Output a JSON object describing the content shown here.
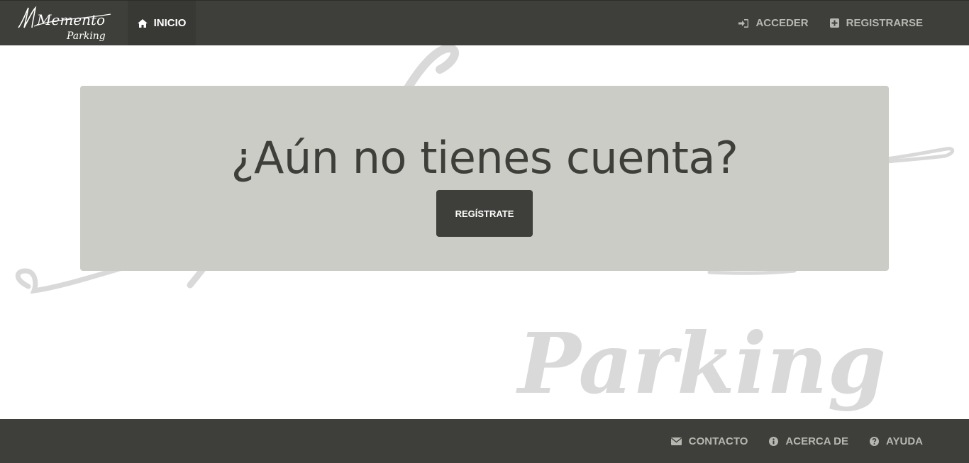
{
  "brand": {
    "logo_text": "Memento",
    "logo_subtext": "Parking"
  },
  "nav": {
    "home": {
      "label": "INICIO",
      "icon": "home-icon"
    },
    "login": {
      "label": "ACCEDER",
      "icon": "sign-in-icon"
    },
    "register": {
      "label": "REGISTRARSE",
      "icon": "plus-square-icon"
    }
  },
  "watermark": {
    "text": "Parking"
  },
  "hero": {
    "title": "¿Aún no tienes cuenta?",
    "button_label": "REGÍSTRATE"
  },
  "footer": {
    "contact": {
      "label": "CONTACTO",
      "icon": "envelope-icon"
    },
    "about": {
      "label": "ACERCA DE",
      "icon": "info-circle-icon"
    },
    "help": {
      "label": "AYUDA",
      "icon": "question-circle-icon"
    }
  },
  "colors": {
    "nav_bg": "#3e3e3a",
    "jumbotron_bg": "#cbccc6",
    "link_muted": "#b7b7b1",
    "watermark": "#d9d9d9"
  }
}
